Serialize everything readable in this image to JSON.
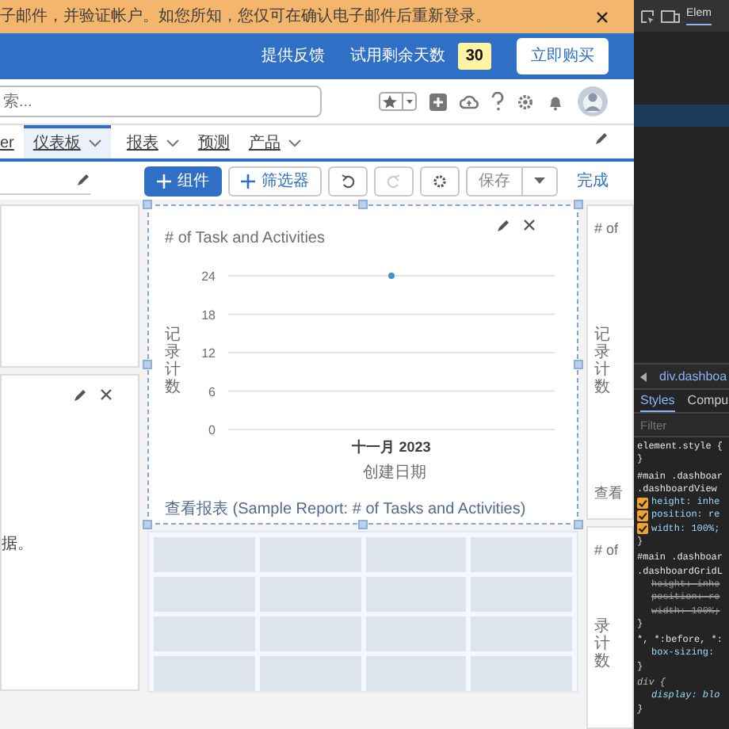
{
  "banner": {
    "text": "子邮件，并验证帐户。如您所知，您仅可在确认电子邮件后重新登录。"
  },
  "header": {
    "feedback": "提供反馈",
    "trial_label": "试用剩余天数",
    "trial_days": "30",
    "buy_button": "立即购买"
  },
  "search": {
    "placeholder": "索..."
  },
  "nav": {
    "tabs": [
      {
        "label": "er",
        "selected": false,
        "dropdown": false
      },
      {
        "label": "仪表板",
        "selected": true,
        "dropdown": true
      },
      {
        "label": "报表",
        "selected": false,
        "dropdown": true
      },
      {
        "label": "预测",
        "selected": false,
        "dropdown": false
      },
      {
        "label": "产品",
        "selected": false,
        "dropdown": true
      }
    ]
  },
  "toolbar": {
    "add_component": "组件",
    "add_filter": "筛选器",
    "redo_disabled": true,
    "save": "保存",
    "done": "完成"
  },
  "dashboard": {
    "columns": [
      {
        "widgets": [
          {
            "kind": "empty",
            "selected": false,
            "actions": false
          },
          {
            "kind": "text",
            "selected": false,
            "actions": true,
            "text": "据。"
          }
        ]
      },
      {
        "widgets": [
          {
            "kind": "chart",
            "selected": true,
            "actions": true,
            "title": "# of Task and Activities",
            "report_link": "查看报表 (Sample Report: # of Tasks and Activities)",
            "chart_data": {
              "type": "line",
              "xlabel": "创建日期",
              "ylabel": "记录计数",
              "categories": [
                "十一月 2023"
              ],
              "series": [
                {
                  "color": "#4a90c8",
                  "marker": true,
                  "values": [
                    24
                  ]
                }
              ],
              "yticks": [
                0,
                6,
                12,
                18,
                24
              ],
              "ylim": [
                0,
                24
              ],
              "grid": true
            }
          },
          {
            "kind": "placeholder",
            "selected": false,
            "actions": false
          }
        ]
      },
      {
        "widgets": [
          {
            "kind": "stub",
            "selected": false,
            "actions": false,
            "title": "# of",
            "ylabel": "记录计数",
            "link": "查看"
          },
          {
            "kind": "stub",
            "selected": false,
            "actions": false,
            "title": "# of",
            "ylabel": "录计数"
          }
        ]
      }
    ]
  },
  "devtools": {
    "tab": "Elem",
    "breadcrumb": "div.dashboa",
    "panel_tabs": [
      {
        "label": "Styles",
        "selected": true
      },
      {
        "label": "Compu",
        "selected": false
      }
    ],
    "filter_placeholder": "Filter",
    "rules": [
      {
        "selector": [
          "element.style {"
        ],
        "user_agent": false,
        "close": "}"
      },
      {
        "selector": [
          "#main .dashboar",
          ".dashboardView"
        ],
        "user_agent": false,
        "props": [
          {
            "text": "height: inhe",
            "checked": true,
            "overridden": false
          },
          {
            "text": "position: re",
            "checked": true,
            "overridden": false
          },
          {
            "text": "width: 100%;",
            "checked": true,
            "overridden": false
          }
        ],
        "close": "}"
      },
      {
        "selector": [
          "#main .dashboar",
          ".dashboardGridL"
        ],
        "user_agent": false,
        "props": [
          {
            "text": "height: inhe",
            "checked": false,
            "overridden": true
          },
          {
            "text": "position: re",
            "checked": false,
            "overridden": true
          },
          {
            "text": "width: 100%;",
            "checked": false,
            "overridden": true
          }
        ],
        "close": "}"
      },
      {
        "selector": [
          "*, *:before, *:"
        ],
        "user_agent": false,
        "props": [
          {
            "text": "box-sizing:",
            "checked": false,
            "overridden": false
          }
        ],
        "close": "}"
      },
      {
        "selector": [
          "div {"
        ],
        "user_agent": true,
        "props": [
          {
            "text": "display: blo",
            "checked": false,
            "overridden": false
          }
        ],
        "close": "}"
      }
    ]
  }
}
